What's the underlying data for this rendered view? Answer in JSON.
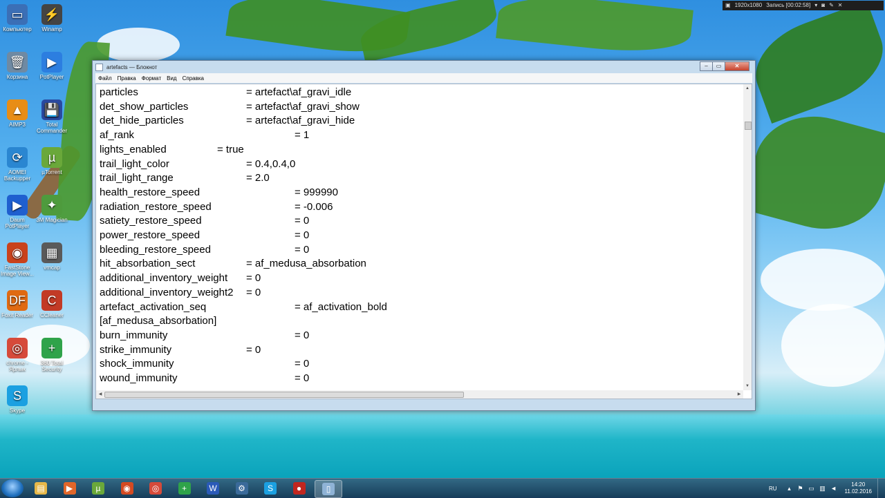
{
  "recording_overlay": {
    "resolution": "1920x1080",
    "record_label": "Запись [00:02:58]"
  },
  "desktop_icons": [
    {
      "label": "Компьютер",
      "icon": "computer-icon",
      "color": "#3b6fb6",
      "glyph": "▭"
    },
    {
      "label": "Winamp",
      "icon": "winamp-icon",
      "color": "#444444",
      "glyph": "⚡"
    },
    {
      "label": "Корзина",
      "icon": "recycle-bin-icon",
      "color": "#6f8aa3",
      "glyph": "🗑"
    },
    {
      "label": "PotPlayer",
      "icon": "potplayer-icon",
      "color": "#2c7ee0",
      "glyph": "▶"
    },
    {
      "label": "AIMP3",
      "icon": "aimp-icon",
      "color": "#e88d16",
      "glyph": "▲"
    },
    {
      "label": "Total Commander",
      "icon": "total-commander-icon",
      "color": "#2a4aa0",
      "glyph": "💾"
    },
    {
      "label": "AOMEI Backupper",
      "icon": "aomei-icon",
      "color": "#2a86d1",
      "glyph": "⟳"
    },
    {
      "label": "µTorrent",
      "icon": "utorrent-icon",
      "color": "#6aa83a",
      "glyph": "µ"
    },
    {
      "label": "Daum PotPlayer",
      "icon": "daum-potplayer-icon",
      "color": "#1f5fcf",
      "glyph": "▶"
    },
    {
      "label": "3M Magician",
      "icon": "magician-icon",
      "color": "#4e9b3d",
      "glyph": "✦"
    },
    {
      "label": "FastStone Image View...",
      "icon": "faststone-icon",
      "color": "#c9421c",
      "glyph": "◉"
    },
    {
      "label": "vmcap",
      "icon": "vmcap-icon",
      "color": "#5a5a5a",
      "glyph": "▦"
    },
    {
      "label": "Foxit Reader",
      "icon": "foxit-icon",
      "color": "#e06a12",
      "glyph": "DF"
    },
    {
      "label": "CCleaner",
      "icon": "ccleaner-icon",
      "color": "#c23a26",
      "glyph": "C"
    },
    {
      "label": "chrome - Ярлык",
      "icon": "chrome-icon",
      "color": "#d64a3a",
      "glyph": "◎"
    },
    {
      "label": "360 Total Security",
      "icon": "360-security-icon",
      "color": "#2fa34a",
      "glyph": "+"
    },
    {
      "label": "Skype",
      "icon": "skype-icon",
      "color": "#1ba0e1",
      "glyph": "S"
    }
  ],
  "window": {
    "title": "artefacts — Блокнот",
    "menu": [
      "Файл",
      "Правка",
      "Формат",
      "Вид",
      "Справка"
    ],
    "lines": [
      {
        "key": "particles",
        "value": "= artefact\\af_gravi_idle",
        "col": 2
      },
      {
        "key": "det_show_particles",
        "value": "= artefact\\af_gravi_show",
        "col": 2
      },
      {
        "key": "det_hide_particles",
        "value": "= artefact\\af_gravi_hide",
        "col": 2
      },
      {
        "key": "af_rank",
        "value": "= 1",
        "col": 3
      },
      {
        "key": "lights_enabled",
        "value": "= true",
        "col": 1
      },
      {
        "key": "trail_light_color",
        "value": "= 0.4,0.4,0",
        "col": 2
      },
      {
        "key": "trail_light_range",
        "value": "= 2.0",
        "col": 2
      },
      {
        "key": "health_restore_speed",
        "value": "= 999990",
        "col": 3
      },
      {
        "key": "radiation_restore_speed",
        "value": "= -0.006",
        "col": 3
      },
      {
        "key": "satiety_restore_speed",
        "value": "= 0",
        "col": 3
      },
      {
        "key": "power_restore_speed",
        "value": "= 0",
        "col": 3
      },
      {
        "key": "bleeding_restore_speed",
        "value": "= 0",
        "col": 3
      },
      {
        "key": "hit_absorbation_sect",
        "value": "= af_medusa_absorbation",
        "col": 2
      },
      {
        "key": "additional_inventory_weight",
        "value": "= 0",
        "col": 2
      },
      {
        "key": "additional_inventory_weight2",
        "value": "= 0",
        "col": 2
      },
      {
        "key": "artefact_activation_seq",
        "value": "= af_activation_bold",
        "col": 3
      },
      {
        "key": "[af_medusa_absorbation]",
        "value": "",
        "col": 0
      },
      {
        "key": "burn_immunity",
        "value": "= 0",
        "col": 3
      },
      {
        "key": "strike_immunity",
        "value": "= 0",
        "col": 2
      },
      {
        "key": "shock_immunity",
        "value": "= 0",
        "col": 3
      },
      {
        "key": "wound_immunity",
        "value": "= 0",
        "col": 3
      }
    ]
  },
  "taskbar": {
    "buttons": [
      {
        "icon": "file-explorer-icon",
        "color": "#e6b84a",
        "glyph": "▤"
      },
      {
        "icon": "media-player-icon",
        "color": "#e0662a",
        "glyph": "▶"
      },
      {
        "icon": "utorrent-icon",
        "color": "#6aa83a",
        "glyph": "µ"
      },
      {
        "icon": "faststone-icon",
        "color": "#d44a22",
        "glyph": "◉"
      },
      {
        "icon": "chrome-icon",
        "color": "#d64a3a",
        "glyph": "◎"
      },
      {
        "icon": "360-security-icon",
        "color": "#2fa34a",
        "glyph": "+"
      },
      {
        "icon": "word-icon",
        "color": "#2a5ab8",
        "glyph": "W"
      },
      {
        "icon": "settings-icon",
        "color": "#3a6a9a",
        "glyph": "⚙"
      },
      {
        "icon": "skype-icon",
        "color": "#1ba0e1",
        "glyph": "S"
      },
      {
        "icon": "recorder-icon",
        "color": "#c0261f",
        "glyph": "●"
      },
      {
        "icon": "notepad-icon",
        "color": "#8fb3d6",
        "glyph": "▯"
      }
    ],
    "language": "RU",
    "time": "14:20",
    "date": "11.02.2016"
  }
}
